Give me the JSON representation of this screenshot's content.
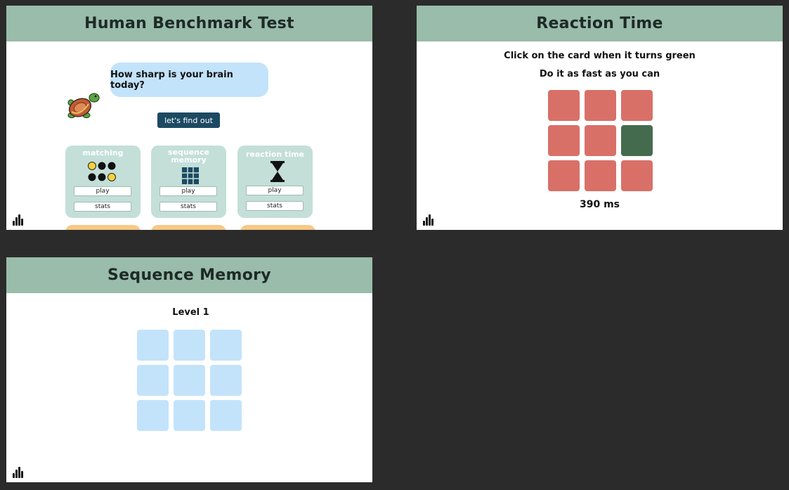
{
  "home": {
    "title": "Human Benchmark Test",
    "bubble_text": "How sharp is your brain today?",
    "find_out_label": "let's find out",
    "cards": [
      {
        "title_line1": "matching",
        "title_line2": "",
        "play": "play",
        "stats": "stats"
      },
      {
        "title_line1": "sequence",
        "title_line2": "memory",
        "play": "play",
        "stats": "stats"
      },
      {
        "title_line1": "reaction time",
        "title_line2": "",
        "play": "play",
        "stats": "stats"
      }
    ],
    "stats_icon": "bar-chart-icon"
  },
  "reaction": {
    "title": "Reaction Time",
    "instruction1": "Click on the card when it turns green",
    "instruction2": "Do it as fast as you can",
    "grid": [
      "red",
      "red",
      "red",
      "red",
      "red",
      "green",
      "red",
      "red",
      "red"
    ],
    "colors": {
      "red": "#d87068",
      "green": "#456b4e"
    },
    "time_text": "390 ms",
    "stats_icon": "bar-chart-icon"
  },
  "sequence": {
    "title": "Sequence Memory",
    "level_text": "Level 1",
    "cell_color": "#c3e3fb",
    "stats_icon": "bar-chart-icon"
  },
  "colors": {
    "header": "#99bcab",
    "card": "#c3dfd8",
    "button_dark": "#1c4a62",
    "orange_card": "#f7c887",
    "background": "#2b2b2b"
  }
}
